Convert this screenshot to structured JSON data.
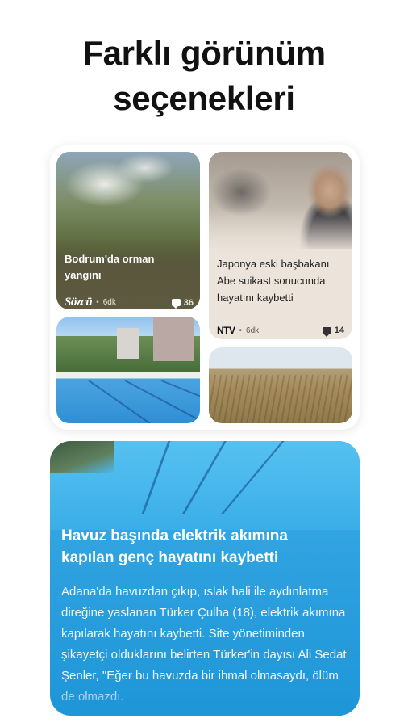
{
  "headline": "Farklı görünüm seçenekleri",
  "cards": [
    {
      "title": "Bodrum'da orman yangını",
      "source": "Sözcü",
      "age": "6dk",
      "comments": "36",
      "accent": "#5e5a40"
    },
    {
      "title": "Japonya eski başbakanı Abe suikast sonucunda hayatını kaybetti",
      "source": "NTV",
      "age": "6dk",
      "comments": "14",
      "accent": "#ece4da"
    }
  ],
  "featured": {
    "title": "Havuz başında elektrik akımına kapılan genç hayatını kaybetti",
    "body": "Adana'da havuzdan çıkıp, ıslak hali ile aydınlatma direğine yaslanan Türker Çulha (18), elektrik akımına kapılarak hayatını kaybetti. Site yönetiminden şikayetçi olduklarını belirten Türker'in dayısı Ali Sedat Şenler, \"Eğer bu havuzda bir ihmal olmasaydı, ölüm de olmazdı.",
    "accent": "#2fa2e0"
  }
}
